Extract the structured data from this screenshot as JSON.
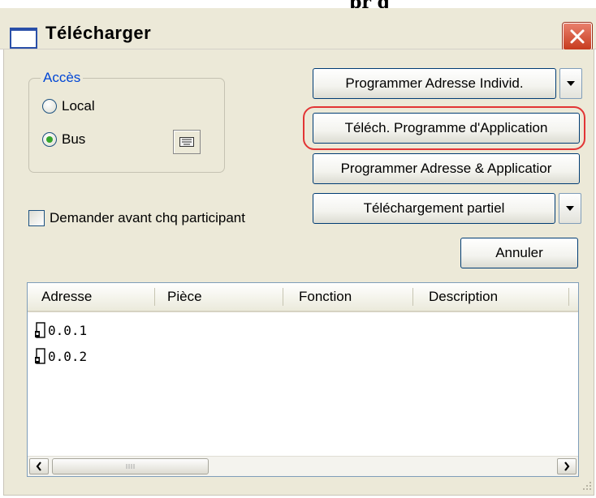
{
  "top_strip_text": "pr g",
  "window": {
    "title": "Télécharger"
  },
  "access_group": {
    "legend": "Accès",
    "options": [
      {
        "label": "Local",
        "selected": false
      },
      {
        "label": "Bus",
        "selected": true
      }
    ]
  },
  "buttons": {
    "program_individual": "Programmer Adresse  Individ.",
    "download_application": "Téléch. Programme d'Application",
    "program_address_application": "Programmer Adresse & Applicatior",
    "partial_download": "Téléchargement partiel",
    "cancel": "Annuler"
  },
  "ask_checkbox": {
    "label": "Demander avant chq participant",
    "checked": false
  },
  "list": {
    "columns": [
      "Adresse",
      "Pièce",
      "Fonction",
      "Description"
    ],
    "rows": [
      {
        "address": "0.0.1"
      },
      {
        "address": "0.0.2"
      }
    ]
  },
  "colors": {
    "dialog_bg": "#ece9d8",
    "group_legend": "#0046d5",
    "highlight_ring": "#e23535",
    "close_button": "#c73b1e",
    "radio_selected": "#36a52c"
  },
  "icons": {
    "window": "window-icon",
    "close": "close-icon",
    "keyboard": "keyboard-icon",
    "dropdown": "triangle-down-icon",
    "device": "device-icon",
    "scroll_left": "arrow-left-icon",
    "scroll_right": "arrow-right-icon",
    "grip": "resize-grip-icon"
  }
}
